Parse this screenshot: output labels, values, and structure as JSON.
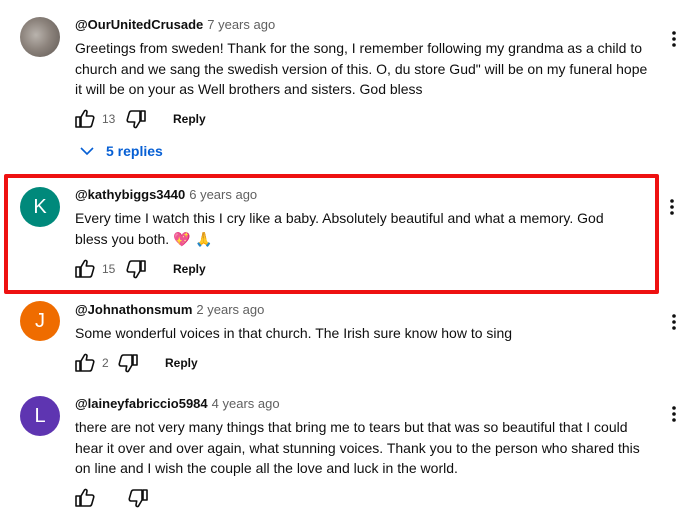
{
  "comments": [
    {
      "author": "@OurUnitedCrusade",
      "time": "7 years ago",
      "text": "Greetings from sweden! Thank for the song, I remember following my grandma as a child to church and we sang the swedish version of this. O, du store Gud\" will be on my funeral hope it will be on your as Well brothers and sisters. God bless",
      "likes": "13",
      "reply_label": "Reply",
      "avatar_icon": "profile-photo",
      "replies_label": "5 replies"
    },
    {
      "author": "@kathybiggs3440",
      "time": "6 years ago",
      "text": "Every time I watch this I cry like a baby.  Absolutely beautiful and what a memory.  God bless you both.",
      "emoji": "💖 🙏",
      "likes": "15",
      "reply_label": "Reply",
      "avatar_letter": "K",
      "avatar_color": "#00897b",
      "highlighted": true
    },
    {
      "author": "@Johnathonsmum",
      "time": "2 years ago",
      "text": "Some wonderful voices in that church. The Irish sure know how to sing",
      "likes": "2",
      "reply_label": "Reply",
      "avatar_letter": "J",
      "avatar_color": "#ef6c00"
    },
    {
      "author": "@laineyfabriccio5984",
      "time": "4 years ago",
      "text": "there are not very many things that bring me to tears but that was so beautiful that I could hear it over and over again, what stunning voices. Thank you to the person who shared this on line and I wish the couple all the love and luck in the world.",
      "avatar_letter": "L",
      "avatar_color": "#5e35b1"
    }
  ],
  "colors": {
    "highlight_border": "#ee1111",
    "link_blue": "#065fd4"
  }
}
